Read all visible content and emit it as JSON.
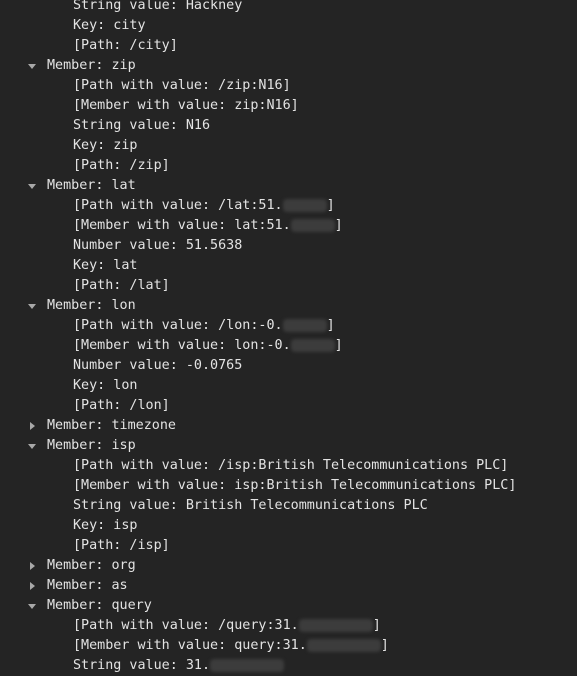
{
  "tree": [
    {
      "kind": "child",
      "text": "String value: Hackney"
    },
    {
      "kind": "child",
      "text": "Key: city"
    },
    {
      "kind": "child",
      "text": "[Path: /city]"
    },
    {
      "kind": "member",
      "expanded": true,
      "text": "Member: zip"
    },
    {
      "kind": "child",
      "text": "[Path with value: /zip:N16]"
    },
    {
      "kind": "child",
      "text": "[Member with value: zip:N16]"
    },
    {
      "kind": "child",
      "text": "String value: N16"
    },
    {
      "kind": "child",
      "text": "Key: zip"
    },
    {
      "kind": "child",
      "text": "[Path: /zip]"
    },
    {
      "kind": "member",
      "expanded": true,
      "text": "Member: lat"
    },
    {
      "kind": "child",
      "text": "[Path with value: /lat:51.",
      "redacted": true,
      "tail": "]"
    },
    {
      "kind": "child",
      "text": "[Member with value: lat:51.",
      "redacted": true,
      "tail": "]"
    },
    {
      "kind": "child",
      "text": "Number value: 51.5638"
    },
    {
      "kind": "child",
      "text": "Key: lat"
    },
    {
      "kind": "child",
      "text": "[Path: /lat]"
    },
    {
      "kind": "member",
      "expanded": true,
      "text": "Member: lon"
    },
    {
      "kind": "child",
      "text": "[Path with value: /lon:-0.",
      "redacted": true,
      "tail": "]"
    },
    {
      "kind": "child",
      "text": "[Member with value: lon:-0.",
      "redacted": true,
      "tail": "]"
    },
    {
      "kind": "child",
      "text": "Number value: -0.0765"
    },
    {
      "kind": "child",
      "text": "Key: lon"
    },
    {
      "kind": "child",
      "text": "[Path: /lon]"
    },
    {
      "kind": "member",
      "expanded": false,
      "text": "Member: timezone"
    },
    {
      "kind": "member",
      "expanded": true,
      "text": "Member: isp"
    },
    {
      "kind": "child",
      "text": "[Path with value: /isp:British Telecommunications PLC]"
    },
    {
      "kind": "child",
      "text": "[Member with value: isp:British Telecommunications PLC]"
    },
    {
      "kind": "child",
      "text": "String value: British Telecommunications PLC"
    },
    {
      "kind": "child",
      "text": "Key: isp"
    },
    {
      "kind": "child",
      "text": "[Path: /isp]"
    },
    {
      "kind": "member",
      "expanded": false,
      "text": "Member: org"
    },
    {
      "kind": "member",
      "expanded": false,
      "text": "Member: as"
    },
    {
      "kind": "member",
      "expanded": true,
      "text": "Member: query"
    },
    {
      "kind": "child",
      "text": "[Path with value: /query:31.",
      "redacted": true,
      "redact_wide": true,
      "tail": "]"
    },
    {
      "kind": "child",
      "text": "[Member with value: query:31.",
      "redacted": true,
      "redact_wide": true,
      "tail": "]"
    },
    {
      "kind": "child",
      "text": "String value: 31.",
      "redacted": true,
      "redact_wide": true,
      "tail": ""
    }
  ],
  "colors": {
    "background": "#242424",
    "text": "#e3e3e3",
    "triangle": "#a8a8a8",
    "redaction": "#3c3c3c"
  }
}
